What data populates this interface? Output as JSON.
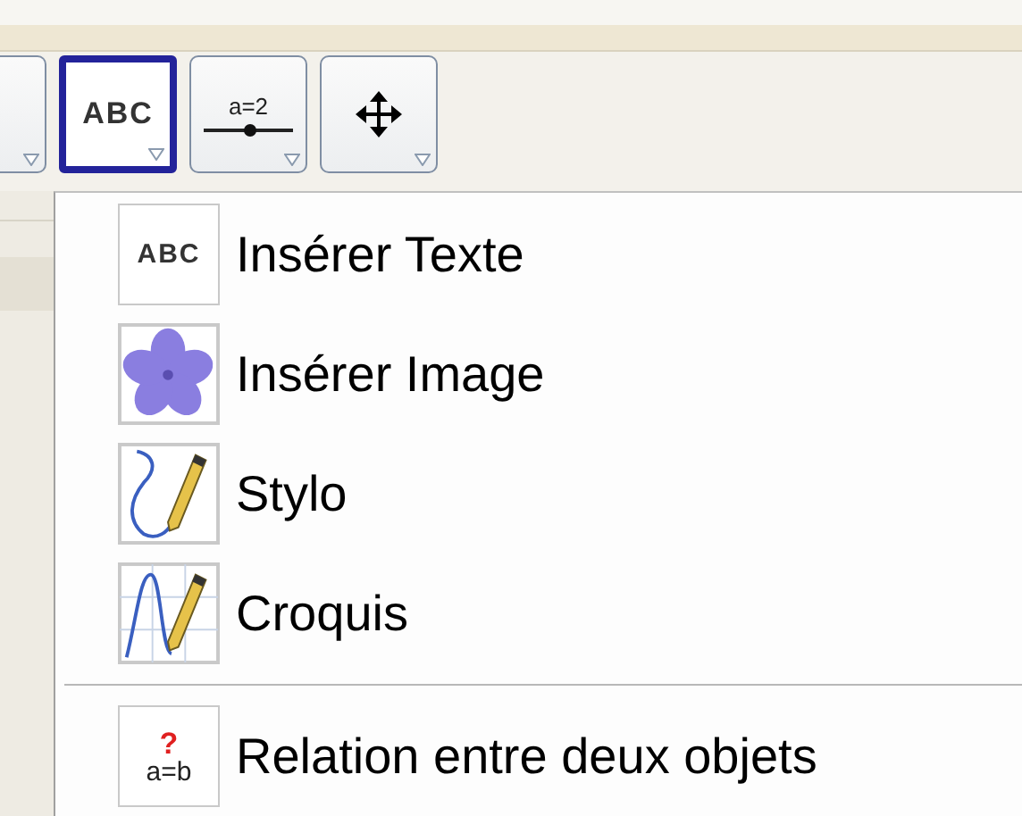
{
  "toolbar": {
    "tools": [
      {
        "kind": "partial",
        "selected": false
      },
      {
        "kind": "text",
        "icon_text": "ABC",
        "selected": true
      },
      {
        "kind": "slider",
        "icon_text": "a=2",
        "selected": false
      },
      {
        "kind": "move",
        "selected": false
      }
    ]
  },
  "menu": {
    "groups": [
      [
        {
          "kind": "text",
          "icon_text": "ABC",
          "label": "Insérer Texte"
        },
        {
          "kind": "image",
          "label": "Insérer Image"
        },
        {
          "kind": "pen",
          "label": "Stylo"
        },
        {
          "kind": "sketch",
          "label": "Croquis"
        }
      ],
      [
        {
          "kind": "relation",
          "icon_mark": "?",
          "icon_text": "a=b",
          "label": "Relation entre deux objets"
        }
      ]
    ]
  }
}
